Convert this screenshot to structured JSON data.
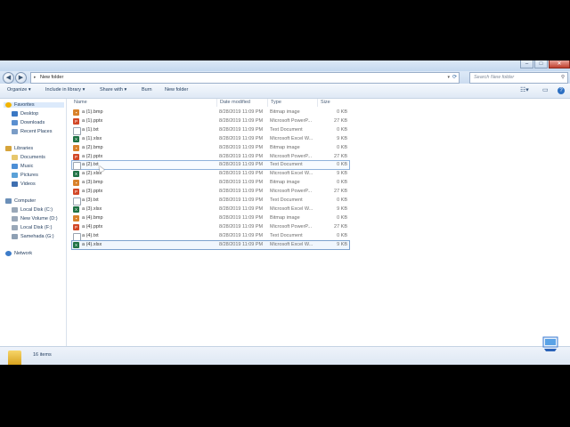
{
  "window": {
    "title_buttons": [
      "–",
      "□",
      "✕"
    ]
  },
  "address": {
    "crumb": "New folder",
    "arrow": "▸",
    "search_placeholder": "Search New folder"
  },
  "toolbar": {
    "organize": "Organize ▾",
    "include": "Include in library ▾",
    "share": "Share with ▾",
    "burn": "Burn",
    "new_folder": "New folder"
  },
  "nav": {
    "favorites": "Favorites",
    "desktop": "Desktop",
    "downloads": "Downloads",
    "recent": "Recent Places",
    "libraries": "Libraries",
    "documents": "Documents",
    "music": "Music",
    "pictures": "Pictures",
    "videos": "Videos",
    "computer": "Computer",
    "disk_c": "Local Disk (C:)",
    "vol_d": "New Volume (D:)",
    "disk_f": "Local Disk (F:)",
    "disk_g": "Samehada (G:)",
    "network": "Network"
  },
  "columns": {
    "name": "Name",
    "date": "Date modified",
    "type": "Type",
    "size": "Size"
  },
  "files": [
    {
      "name": "a (1).bmp",
      "date": "8/28/2019 11:09 PM",
      "type": "Bitmap image",
      "size": "0 KB",
      "kind": "bmp"
    },
    {
      "name": "a (1).pptx",
      "date": "8/28/2019 11:09 PM",
      "type": "Microsoft PowerP...",
      "size": "27 KB",
      "kind": "pptx"
    },
    {
      "name": "a (1).txt",
      "date": "8/28/2019 11:09 PM",
      "type": "Text Document",
      "size": "0 KB",
      "kind": "txt"
    },
    {
      "name": "a (1).xlsx",
      "date": "8/28/2019 11:09 PM",
      "type": "Microsoft Excel W...",
      "size": "9 KB",
      "kind": "xlsx"
    },
    {
      "name": "a (2).bmp",
      "date": "8/28/2019 11:09 PM",
      "type": "Bitmap image",
      "size": "0 KB",
      "kind": "bmp"
    },
    {
      "name": "a (2).pptx",
      "date": "8/28/2019 11:09 PM",
      "type": "Microsoft PowerP...",
      "size": "27 KB",
      "kind": "pptx"
    },
    {
      "name": "a (2).txt",
      "date": "8/28/2019 11:09 PM",
      "type": "Text Document",
      "size": "0 KB",
      "kind": "txt"
    },
    {
      "name": "a (2).xlsx",
      "date": "8/28/2019 11:09 PM",
      "type": "Microsoft Excel W...",
      "size": "9 KB",
      "kind": "xlsx"
    },
    {
      "name": "a (3).bmp",
      "date": "8/28/2019 11:09 PM",
      "type": "Bitmap image",
      "size": "0 KB",
      "kind": "bmp"
    },
    {
      "name": "a (3).pptx",
      "date": "8/28/2019 11:09 PM",
      "type": "Microsoft PowerP...",
      "size": "27 KB",
      "kind": "pptx"
    },
    {
      "name": "a (3).txt",
      "date": "8/28/2019 11:09 PM",
      "type": "Text Document",
      "size": "0 KB",
      "kind": "txt"
    },
    {
      "name": "a (3).xlsx",
      "date": "8/28/2019 11:09 PM",
      "type": "Microsoft Excel W...",
      "size": "9 KB",
      "kind": "xlsx"
    },
    {
      "name": "a (4).bmp",
      "date": "8/28/2019 11:09 PM",
      "type": "Bitmap image",
      "size": "0 KB",
      "kind": "bmp"
    },
    {
      "name": "a (4).pptx",
      "date": "8/28/2019 11:09 PM",
      "type": "Microsoft PowerP...",
      "size": "27 KB",
      "kind": "pptx"
    },
    {
      "name": "a (4).txt",
      "date": "8/28/2019 11:09 PM",
      "type": "Text Document",
      "size": "0 KB",
      "kind": "txt"
    },
    {
      "name": "a (4).xlsx",
      "date": "8/28/2019 11:09 PM",
      "type": "Microsoft Excel W...",
      "size": "9 KB",
      "kind": "xlsx"
    }
  ],
  "status": {
    "count": "16 items"
  },
  "colors": {
    "bmp": "#d9822b",
    "pptx": "#d24726",
    "txt": "#ffffff",
    "xlsx": "#1f7244",
    "accent": "#1e395b"
  }
}
